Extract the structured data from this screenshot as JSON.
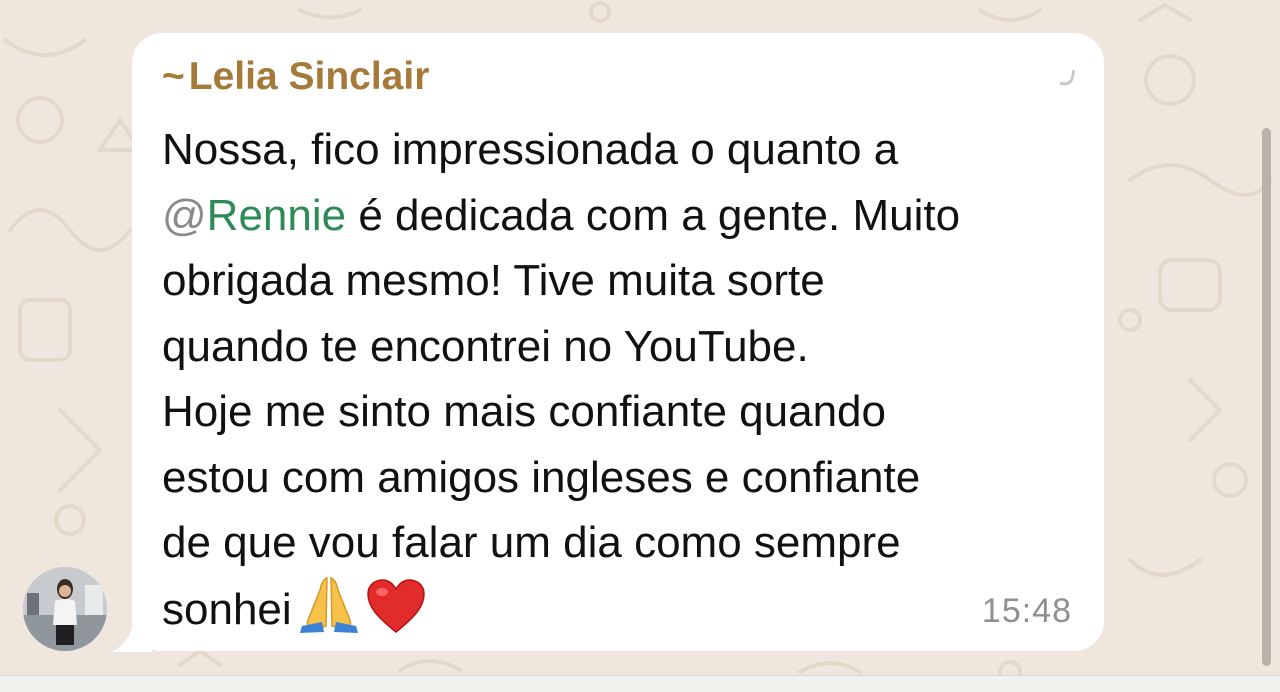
{
  "chat": {
    "sender_prefix": "~",
    "sender_name": "Lelia Sinclair",
    "message": {
      "line1": "Nossa, fico impressionada o quanto a",
      "mention_at": "@",
      "mention_name": "Rennie",
      "line2_rest": " é dedicada com a gente. Muito",
      "line3": "obrigada mesmo! Tive muita sorte",
      "line4": "quando te encontrei no YouTube.",
      "line5": "Hoje me sinto mais confiante quando",
      "line6": "estou com amigos ingleses e confiante",
      "line7": "de que vou falar um dia como sempre",
      "line8": "sonhei"
    },
    "emojis": [
      "folded-hands-icon",
      "red-heart-icon"
    ],
    "timestamp": "15:48"
  },
  "colors": {
    "wallpaper": "#efe7dd",
    "bubble": "#ffffff",
    "sender_name": "#a57a38",
    "mention": "#2e8b57",
    "timestamp": "#8f8f8f"
  }
}
